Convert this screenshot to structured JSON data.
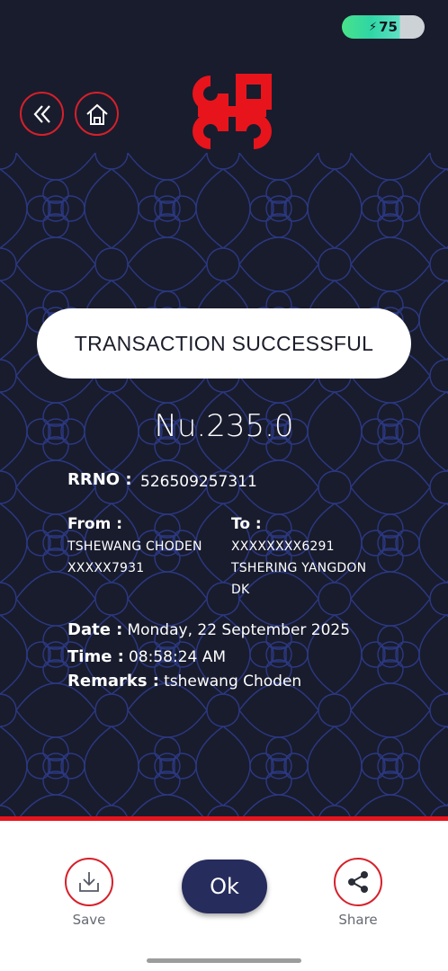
{
  "status_bar": {
    "battery_level": "75",
    "battery_color": "#3fd99a"
  },
  "nav": {
    "back_icon": "double-chevron-left-icon",
    "home_icon": "home-icon"
  },
  "brand": {
    "logo": "endless-knot-logo",
    "accent_color": "#e8141c"
  },
  "transaction": {
    "status_text": "TRANSACTION SUCCESSFUL",
    "amount": "Nu.235.0",
    "rrno_label": "RRNO :",
    "rrno_value": "526509257311",
    "from_label": "From :",
    "from_name": "TSHEWANG CHODEN",
    "from_account": "XXXXX7931",
    "to_label": "To :",
    "to_account": "XXXXXXXX6291",
    "to_name_line1": "TSHERING YANGDON",
    "to_name_line2": "DK",
    "date_label": "Date :",
    "date_value": "Monday, 22 September 2025",
    "time_label": "Time :",
    "time_value": "08:58:24 AM",
    "remarks_label": "Remarks :",
    "remarks_value": "tshewang Choden"
  },
  "actions": {
    "save_label": "Save",
    "ok_label": "Ok",
    "share_label": "Share"
  },
  "colors": {
    "background": "#191c2d",
    "ok_button": "#262c5c",
    "pattern": "#2c3a8c"
  }
}
